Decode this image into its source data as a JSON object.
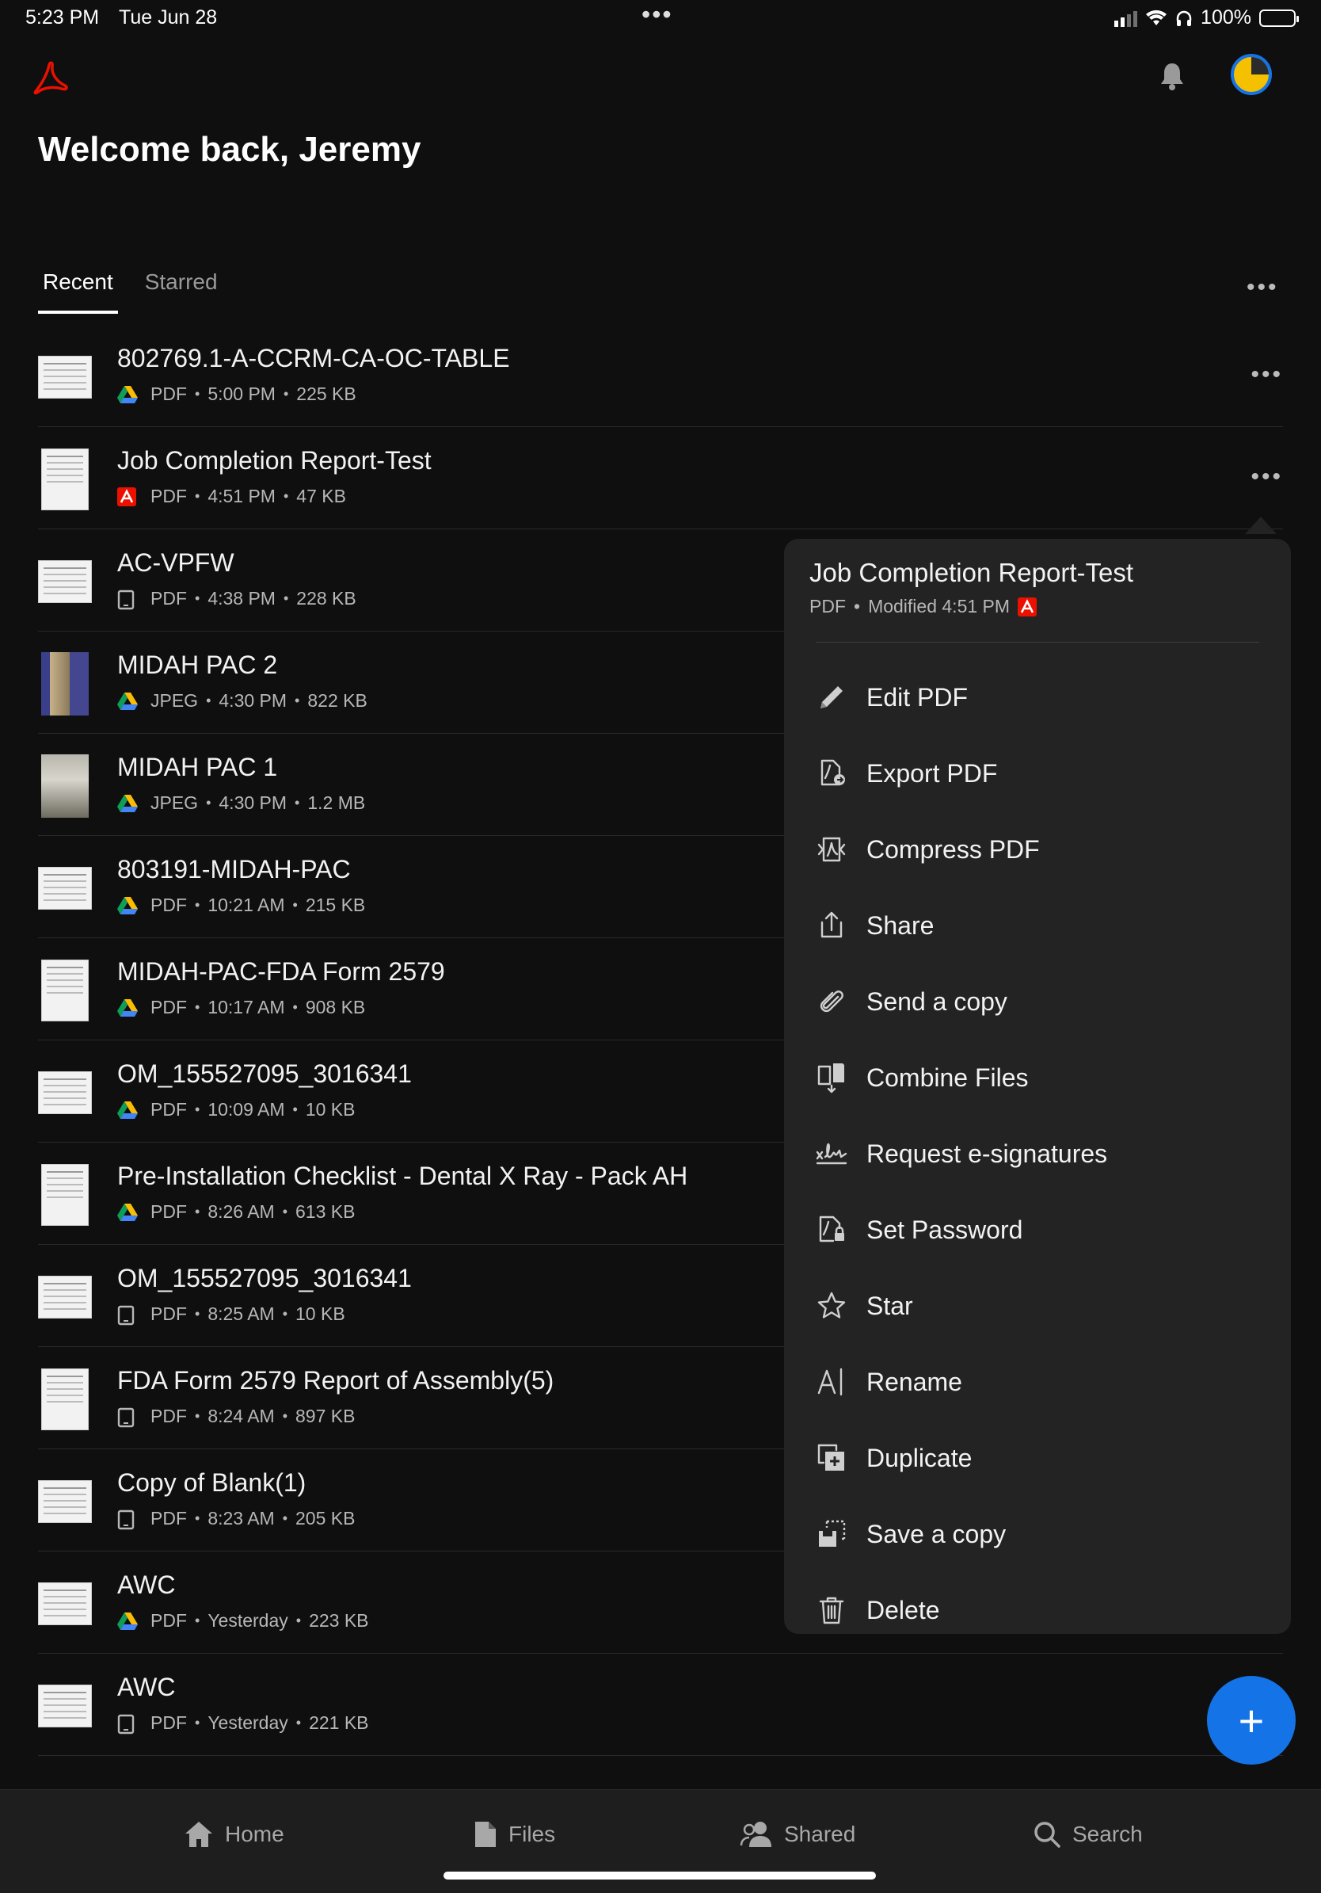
{
  "status": {
    "time": "5:23 PM",
    "date": "Tue Jun 28",
    "dots": "•••",
    "battery": "100%"
  },
  "header": {
    "welcome": "Welcome back, Jeremy"
  },
  "tabs": [
    {
      "label": "Recent"
    },
    {
      "label": "Starred"
    }
  ],
  "tabs_more": "•••",
  "row_more": "•••",
  "files": [
    {
      "name": "802769.1-A-CCRM-CA-OC-TABLE",
      "type": "PDF",
      "time": "5:00 PM",
      "size": "225 KB",
      "source": "google-drive-icon"
    },
    {
      "name": "Job Completion Report-Test",
      "type": "PDF",
      "time": "4:51 PM",
      "size": "47 KB",
      "source": "acrobat-icon"
    },
    {
      "name": "AC-VPFW",
      "type": "PDF",
      "time": "4:38 PM",
      "size": "228 KB",
      "source": "device-icon"
    },
    {
      "name": "MIDAH PAC 2",
      "type": "JPEG",
      "time": "4:30 PM",
      "size": "822 KB",
      "source": "google-drive-icon"
    },
    {
      "name": "MIDAH PAC 1",
      "type": "JPEG",
      "time": "4:30 PM",
      "size": "1.2 MB",
      "source": "google-drive-icon"
    },
    {
      "name": "803191-MIDAH-PAC",
      "type": "PDF",
      "time": "10:21 AM",
      "size": "215 KB",
      "source": "google-drive-icon"
    },
    {
      "name": "MIDAH-PAC-FDA Form 2579",
      "type": "PDF",
      "time": "10:17 AM",
      "size": "908 KB",
      "source": "google-drive-icon"
    },
    {
      "name": "OM_155527095_3016341",
      "type": "PDF",
      "time": "10:09 AM",
      "size": "10 KB",
      "source": "google-drive-icon"
    },
    {
      "name": "Pre-Installation Checklist - Dental X Ray - Pack AH",
      "type": "PDF",
      "time": "8:26 AM",
      "size": "613 KB",
      "source": "google-drive-icon"
    },
    {
      "name": "OM_155527095_3016341",
      "type": "PDF",
      "time": "8:25 AM",
      "size": "10 KB",
      "source": "device-icon"
    },
    {
      "name": "FDA Form 2579 Report of Assembly(5)",
      "type": "PDF",
      "time": "8:24 AM",
      "size": "897 KB",
      "source": "device-icon"
    },
    {
      "name": "Copy of Blank(1)",
      "type": "PDF",
      "time": "8:23 AM",
      "size": "205 KB",
      "source": "device-icon"
    },
    {
      "name": "AWC",
      "type": "PDF",
      "time": "Yesterday",
      "size": "223 KB",
      "source": "google-drive-icon"
    },
    {
      "name": "AWC",
      "type": "PDF",
      "time": "Yesterday",
      "size": "221 KB",
      "source": "device-icon"
    }
  ],
  "popover": {
    "title": "Job Completion Report-Test",
    "type": "PDF",
    "modified": "Modified 4:51 PM",
    "items": [
      {
        "label": "Edit PDF",
        "icon": "pencil-icon"
      },
      {
        "label": "Export PDF",
        "icon": "export-pdf-icon"
      },
      {
        "label": "Compress PDF",
        "icon": "compress-pdf-icon"
      },
      {
        "label": "Share",
        "icon": "share-icon"
      },
      {
        "label": "Send a copy",
        "icon": "paperclip-icon"
      },
      {
        "label": "Combine Files",
        "icon": "combine-files-icon"
      },
      {
        "label": "Request e-signatures",
        "icon": "e-signature-icon"
      },
      {
        "label": "Set Password",
        "icon": "lock-file-icon"
      },
      {
        "label": "Star",
        "icon": "star-icon"
      },
      {
        "label": "Rename",
        "icon": "rename-icon"
      },
      {
        "label": "Duplicate",
        "icon": "duplicate-icon"
      },
      {
        "label": "Save a copy",
        "icon": "save-copy-icon"
      },
      {
        "label": "Delete",
        "icon": "trash-icon"
      }
    ]
  },
  "fab": "+",
  "nav": [
    {
      "label": "Home",
      "icon": "home-icon"
    },
    {
      "label": "Files",
      "icon": "files-icon"
    },
    {
      "label": "Shared",
      "icon": "shared-icon"
    },
    {
      "label": "Search",
      "icon": "search-icon"
    }
  ],
  "colors": {
    "accent": "#1473e6",
    "background": "#0f0f0f",
    "popover": "#232323",
    "acrobat_red": "#eb1000"
  }
}
